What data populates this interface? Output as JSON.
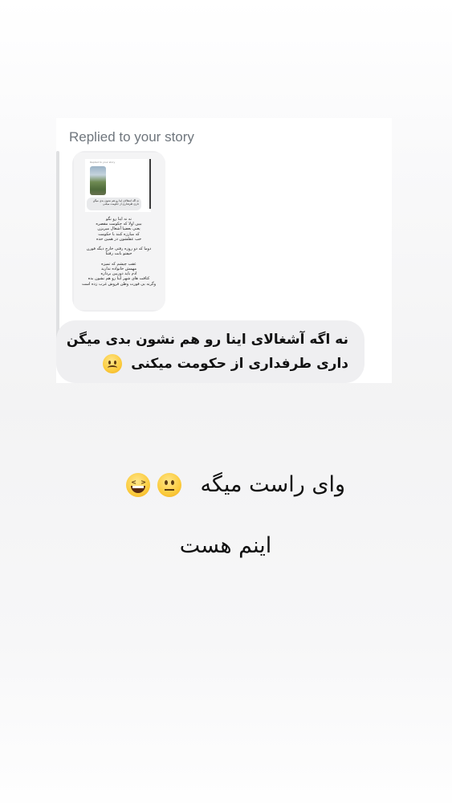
{
  "reply": {
    "label": "Replied to your story",
    "story_preview": {
      "label": "Replied to your story",
      "bubble_text": "نه اگه اشغالای اینا رو هم نشون بدی میگن\nداری طرفداری از حکومت میکنی",
      "body_text": "نه نه اینا رو نگو\nببین اولا که حکومت مقصره\nیعنی بعضیا آشغال میریزن\nکه مبارزه کنند با حکومت\nخب عقلشون در همین حده\n\nدوما که دو روزه رفتی خارج دیگه فورن\nحیفتو بابت رفتنا\n\nعقب چیشم که تمیزه\nمهمش خانواده ندارید\nادم باید دوربین برداره\nکثافت های شهر اینا رو هم نشون بده\nوگرنه بی فورت وطن فروش غرب زده است"
    },
    "message_line_1": "نه اگه آشغالای اینا رو هم نشون بدی میگن",
    "message_line_2": "داری طرفداری از حکومت میکنی",
    "message_emoji": "frowning-face"
  },
  "caption": {
    "line_1": "وای راست میگه",
    "line_1_emojis": [
      "neutral-face",
      "grinning-squinting-face"
    ],
    "line_2": "اینم هست"
  },
  "colors": {
    "label_gray": "#6f767d",
    "bubble_bg": "#efeff1",
    "text": "#111111",
    "emoji_yellow": "#fbcb3d"
  }
}
